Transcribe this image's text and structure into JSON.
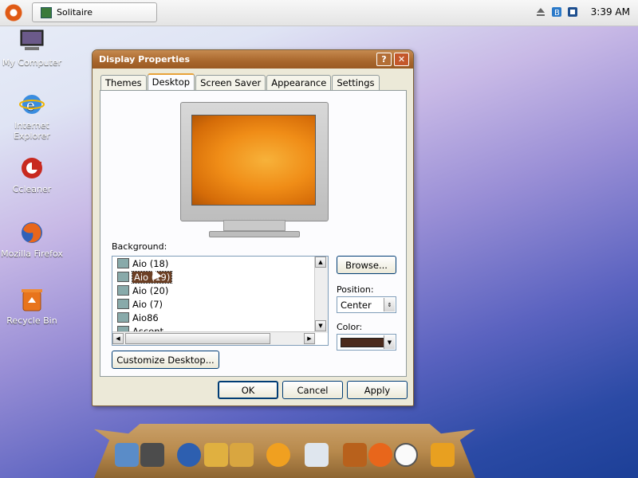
{
  "taskbar": {
    "task_title": "Solitaire",
    "clock": "3:39 AM"
  },
  "desktop_icons": [
    {
      "label": "My Computer"
    },
    {
      "label": "Internet Explorer"
    },
    {
      "label": "Ccleaner"
    },
    {
      "label": "Mozilla Firefox"
    },
    {
      "label": "Recycle Bin"
    }
  ],
  "window": {
    "title": "Display Properties",
    "title_buttons": {
      "help": "?",
      "close": "✕"
    },
    "tabs": [
      {
        "label": "Themes"
      },
      {
        "label": "Desktop"
      },
      {
        "label": "Screen Saver"
      },
      {
        "label": "Appearance"
      },
      {
        "label": "Settings"
      }
    ],
    "active_tab": "Desktop",
    "background_label": "Background:",
    "backgrounds": [
      {
        "label": "Aio (18)"
      },
      {
        "label": "Aio (19)"
      },
      {
        "label": "Aio (20)"
      },
      {
        "label": "Aio (7)"
      },
      {
        "label": "Aio86"
      },
      {
        "label": "Ascent"
      }
    ],
    "selected_background": "Aio (19)",
    "browse_label": "Browse...",
    "position_label": "Position:",
    "position_value": "Center",
    "color_label": "Color:",
    "color_value": "#4b2a1c",
    "customize_label": "Customize Desktop...",
    "ok_label": "OK",
    "cancel_label": "Cancel",
    "apply_label": "Apply"
  },
  "colors": {
    "titlebar": "#a8662c",
    "selection": "#6b3f24",
    "preview_accent": "#f08d17"
  }
}
